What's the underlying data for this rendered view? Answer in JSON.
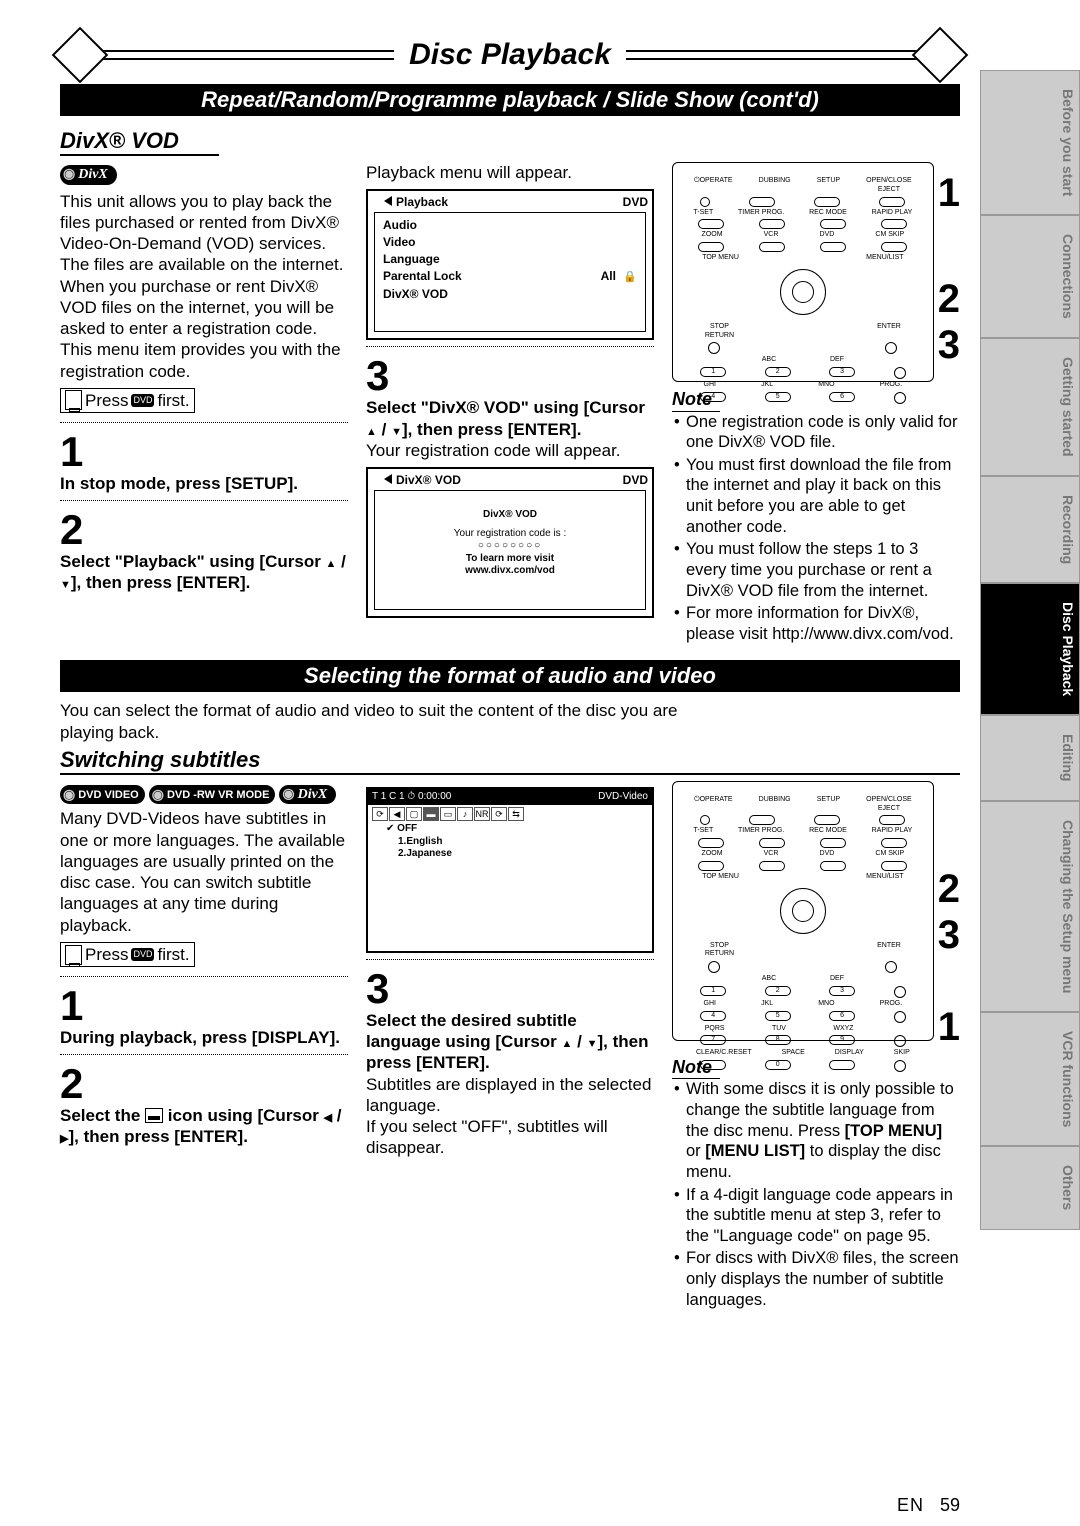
{
  "chapter_title": "Disc Playback",
  "section1_title": "Repeat/Random/Programme playback / Slide Show (cont'd)",
  "section2_title": "Selecting the format of audio and video",
  "divx": {
    "heading": "DivX® VOD",
    "badge": "DivX",
    "intro": "This unit allows you to play back the files purchased or rented from DivX® Video-On-Demand (VOD) services. The files are available on the internet. When you purchase or rent DivX® VOD files on the internet, you will be asked to enter a registration code. This menu item provides you with the registration code.",
    "press_label_pre": "Press",
    "press_icon_label": "DVD",
    "press_label_post": "first.",
    "step1_text": "In stop mode, press [SETUP].",
    "step2_text_a": "Select \"Playback\" using [Cursor ",
    "step2_text_b": "], then press [ENTER].",
    "playback_caption": "Playback menu will appear.",
    "step3_text_a": "Select \"DivX® VOD\" using [Cursor ",
    "step3_text_b": "], then press [ENTER].",
    "reg_caption": "Your registration code will appear.",
    "note_items": [
      "One registration code is only valid for one DivX® VOD file.",
      "You must first download the file from the internet and play it back on this unit before you are able to get another code.",
      "You must follow the steps 1 to 3 every time you purchase or rent a DivX® VOD file from the internet.",
      "For more information for DivX®, please visit http://www.divx.com/vod."
    ]
  },
  "playback_screen": {
    "title": "Playback",
    "disc": "DVD",
    "items": [
      {
        "l": "Audio",
        "r": ""
      },
      {
        "l": "Video",
        "r": ""
      },
      {
        "l": "Language",
        "r": ""
      },
      {
        "l": "Parental Lock",
        "r": "All"
      },
      {
        "l": "DivX® VOD",
        "r": ""
      }
    ]
  },
  "vod_screen": {
    "title": "DivX® VOD",
    "disc": "DVD",
    "t1": "DivX® VOD",
    "t2": "Your registration code is :",
    "t3": "○○○○○○○○",
    "t4": "To learn more visit",
    "t5": "www.divx.com/vod"
  },
  "remote_labels1": [
    "OPERATE",
    "DUBBING",
    "SETUP",
    "OPEN/CLOSE EJECT",
    "T-SET",
    "TIMER PROG.",
    "REC MODE",
    "RAPID PLAY",
    "ZOOM",
    "VCR",
    "DVD",
    "CM SKIP",
    "TOP MENU",
    "MENU / LIST",
    "STOP RETURN",
    "ENTER",
    "ABC",
    "DEF",
    "PROG.",
    "GHI",
    "JKL",
    "MNO"
  ],
  "remote_nums1": [
    "1",
    "2",
    "3"
  ],
  "fmt_intro": "You can select the format of audio and video to suit the content of the disc you are playing back.",
  "subs": {
    "heading": "Switching subtitles",
    "badges": [
      "DVD VIDEO",
      "DVD -RW VR MODE",
      "DivX"
    ],
    "intro": "Many DVD-Videos have subtitles in one or more languages. The available languages are usually printed on the disc case. You can switch subtitle languages at any time during playback.",
    "step1_text": "During playback, press [DISPLAY].",
    "step2_text_a": "Select the ",
    "step2_text_b": " icon using [Cursor ",
    "step2_text_c": "], then press [ENTER].",
    "step3_text_a": "Select the desired subtitle language using [Cursor ",
    "step3_text_b": "], then press [ENTER].",
    "step3_body1": "Subtitles are displayed in the selected language.",
    "step3_body2": "If you select \"OFF\", subtitles will disappear.",
    "note_items": [
      "With some discs it is only possible to change the subtitle language from the disc menu. Press [TOP MENU] or [MENU LIST] to display the disc menu.",
      "If a 4-digit language code appears in the subtitle menu at step 3, refer to the \"Language code\" on page 95.",
      "For discs with DivX® files, the screen only displays the number of subtitle languages."
    ],
    "note_bold1": "[TOP MENU]",
    "note_bold2": "[MENU LIST]"
  },
  "display_screen": {
    "top_l": "T  1  C  1  ⏱  0:00:00",
    "top_r": "DVD-Video",
    "items": [
      "OFF",
      "1.English",
      "2.Japanese"
    ]
  },
  "remote_nums2": [
    "2",
    "3",
    "1"
  ],
  "note_label": "Note",
  "side_tabs": [
    "Before you start",
    "Connections",
    "Getting started",
    "Recording",
    "Disc Playback",
    "Editing",
    "Changing the Setup menu",
    "VCR functions",
    "Others"
  ],
  "side_active_index": 4,
  "page_lang": "EN",
  "page_num": "59"
}
